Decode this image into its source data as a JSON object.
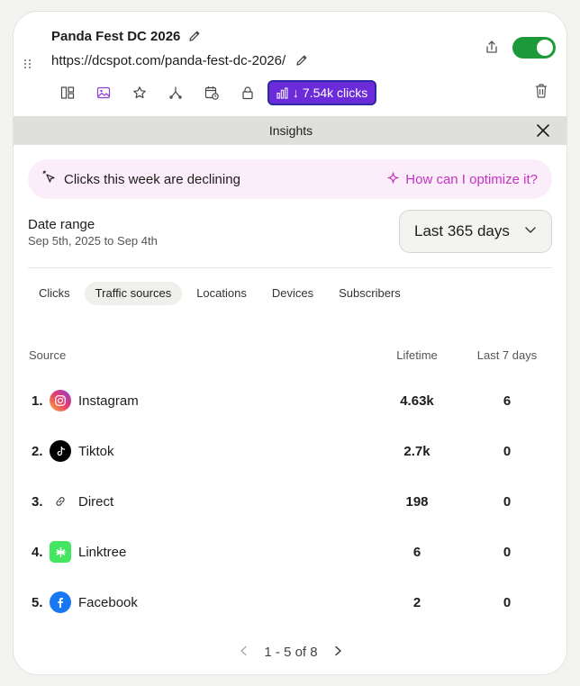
{
  "link": {
    "title": "Panda Fest DC 2026",
    "url": "https://dcspot.com/panda-fest-dc-2026/",
    "enabled": true,
    "clicks_label": "7.54k clicks"
  },
  "toolbar": {
    "icons": [
      "layout-icon",
      "image-icon",
      "star-icon",
      "redirect-icon",
      "schedule-icon",
      "lock-icon"
    ]
  },
  "insights": {
    "title": "Insights",
    "alert_text": "Clicks this week are declining",
    "optimize_text": "How can I optimize it?",
    "date_range_label": "Date range",
    "date_range_sub": "Sep 5th, 2025 to Sep 4th",
    "range_selected": "Last 365 days"
  },
  "tabs": [
    {
      "label": "Clicks",
      "active": false
    },
    {
      "label": "Traffic sources",
      "active": true
    },
    {
      "label": "Locations",
      "active": false
    },
    {
      "label": "Devices",
      "active": false
    },
    {
      "label": "Subscribers",
      "active": false
    }
  ],
  "table": {
    "headers": {
      "source": "Source",
      "lifetime": "Lifetime",
      "last7": "Last 7 days"
    },
    "rows": [
      {
        "rank": "1.",
        "source": "Instagram",
        "lifetime": "4.63k",
        "last7": "6",
        "icon": "instagram-icon"
      },
      {
        "rank": "2.",
        "source": "Tiktok",
        "lifetime": "2.7k",
        "last7": "0",
        "icon": "tiktok-icon"
      },
      {
        "rank": "3.",
        "source": "Direct",
        "lifetime": "198",
        "last7": "0",
        "icon": "link-icon"
      },
      {
        "rank": "4.",
        "source": "Linktree",
        "lifetime": "6",
        "last7": "0",
        "icon": "linktree-icon"
      },
      {
        "rank": "5.",
        "source": "Facebook",
        "lifetime": "2",
        "last7": "0",
        "icon": "facebook-icon"
      }
    ]
  },
  "pagination": {
    "label": "1 - 5 of 8"
  },
  "colors": {
    "accent": "#6c2bd9",
    "toggle_on": "#1c9a3a",
    "alert_bg": "#fbeefa",
    "optimize": "#c532c3"
  }
}
